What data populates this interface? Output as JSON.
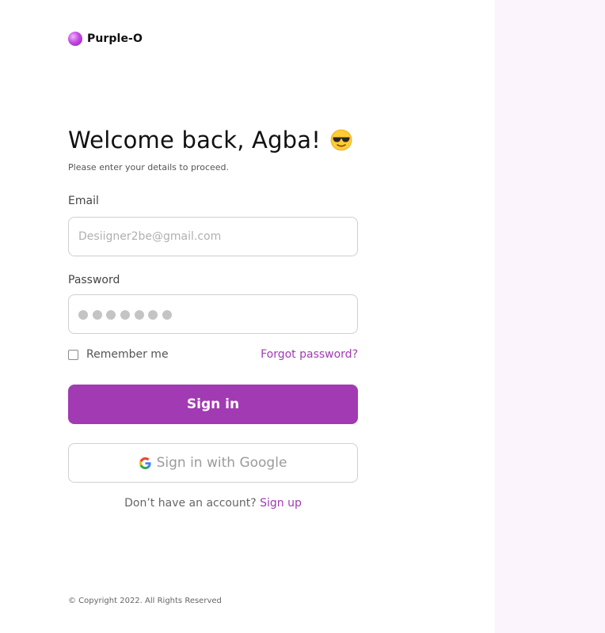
{
  "brand": {
    "name": "Purple-O",
    "accent": "#a23ab3",
    "panel_color": "#fcf4fd"
  },
  "header": {
    "title": "Welcome back, Agba!",
    "emoji": "smiling-face-with-sunglasses-icon",
    "subtitle": "Please enter your details to proceed."
  },
  "form": {
    "email_label": "Email",
    "email_placeholder": "Desiigner2be@gmail.com",
    "password_label": "Password",
    "password_mask_count": 7,
    "remember_label": "Remember me",
    "remember_checked": false,
    "forgot_label": "Forgot password?",
    "signin_label": "Sign in",
    "google_label": "Sign in with Google"
  },
  "signup": {
    "prompt": "Don’t have an account?",
    "link": "Sign up"
  },
  "footer": {
    "copyright": "© Copyright 2022. All Rights Reserved"
  }
}
